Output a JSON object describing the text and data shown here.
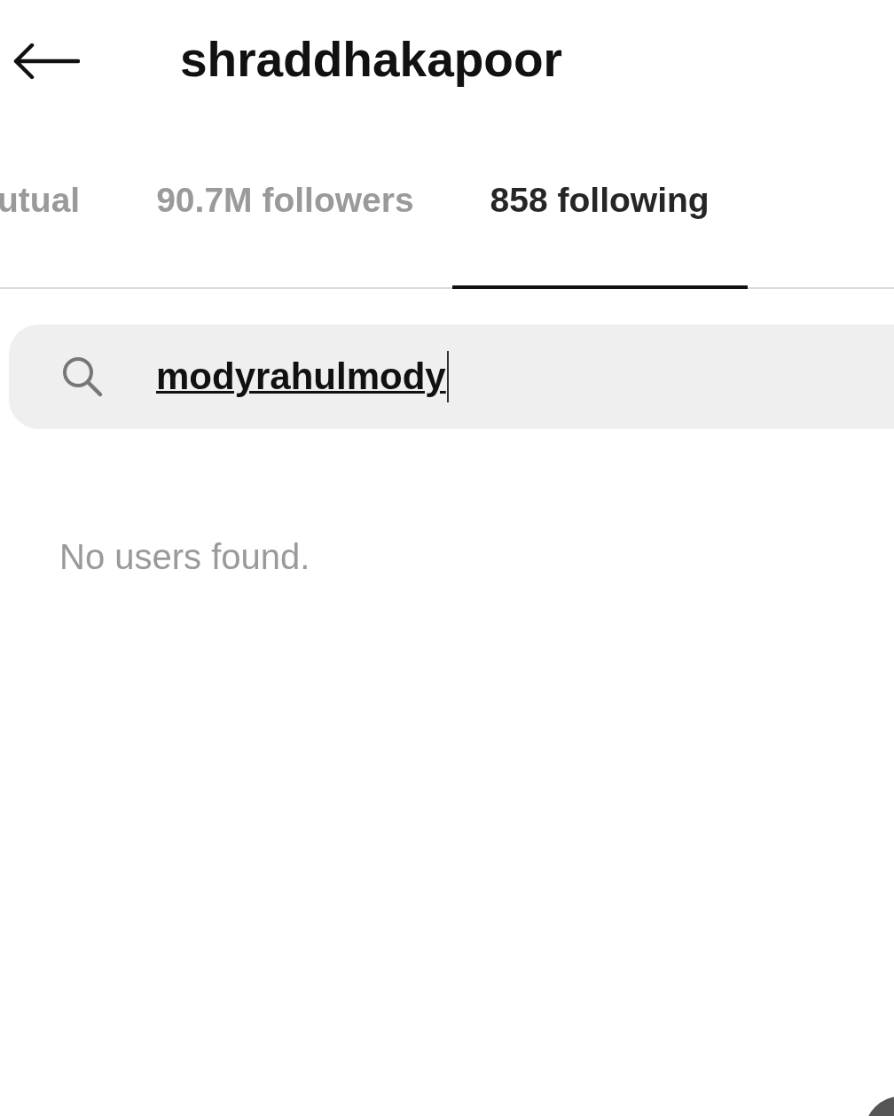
{
  "header": {
    "title": "shraddhakapoor"
  },
  "tabs": [
    {
      "label": "utual",
      "selected": false
    },
    {
      "label": "90.7M followers",
      "selected": false
    },
    {
      "label": "858 following",
      "selected": true
    }
  ],
  "search": {
    "value": "modyrahulmody",
    "focused": true
  },
  "empty_message": "No users found."
}
